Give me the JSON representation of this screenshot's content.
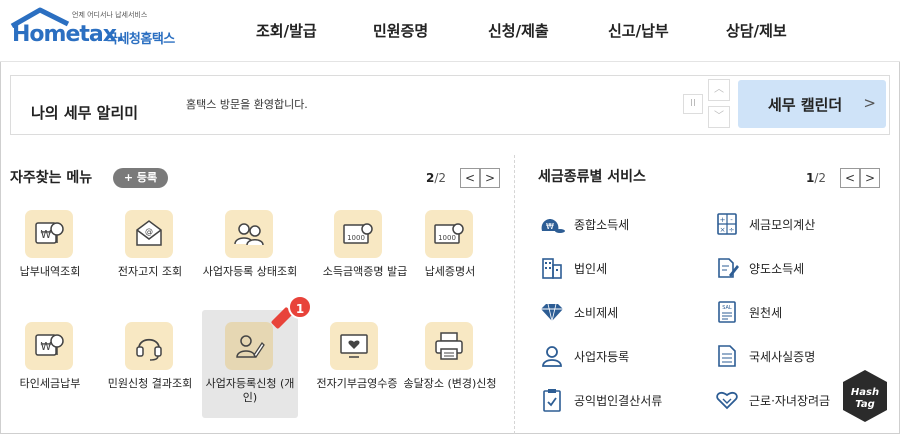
{
  "header": {
    "logo_tagline": "언제 어디서나 납세서비스",
    "logo_text": "Hometax.",
    "logo_kr": "국세청홈택스",
    "nav": [
      "조회/발급",
      "민원증명",
      "신청/제출",
      "신고/납부",
      "상담/제보"
    ]
  },
  "notice": {
    "title": "나의 세무 알리미",
    "message": "홈택스 방문을 환영합니다.",
    "pause_symbol": "II",
    "up_symbol": "︿",
    "down_symbol": "﹀",
    "calendar_button": "세무 캘린더",
    "calendar_chevron": ">"
  },
  "frequent": {
    "title": "자주찾는 메뉴",
    "register_button": "+ 등록",
    "page_current": "2",
    "page_total": "/2",
    "prev": "<",
    "next": ">",
    "items": [
      {
        "label": "납부내역조회",
        "icon": "won-search-icon"
      },
      {
        "label": "전자고지 조회",
        "icon": "envelope-at-icon"
      },
      {
        "label": "사업자등록 상태조회",
        "icon": "people-search-icon"
      },
      {
        "label": "소득금액증명 발급",
        "icon": "certificate-1000-icon"
      },
      {
        "label": "납세증명서",
        "icon": "certificate-1000-icon"
      },
      {
        "label": "타인세금납부",
        "icon": "won-search-icon"
      },
      {
        "label": "민원신청 결과조회",
        "icon": "headset-icon"
      },
      {
        "label": "사업자등록신청 (개인)",
        "icon": "person-pen-icon"
      },
      {
        "label": "전자기부금영수증",
        "icon": "monitor-heart-icon"
      },
      {
        "label": "송달장소 (변경)신청",
        "icon": "printer-icon"
      }
    ],
    "badge_number": "1"
  },
  "services": {
    "title": "세금종류별 서비스",
    "page_current": "1",
    "page_total": "/2",
    "prev": "<",
    "next": ">",
    "items": [
      {
        "label": "종합소득세",
        "icon": "money-bag-icon"
      },
      {
        "label": "세금모의계산",
        "icon": "calculator-icon"
      },
      {
        "label": "법인세",
        "icon": "building-icon"
      },
      {
        "label": "양도소득세",
        "icon": "document-pen-icon"
      },
      {
        "label": "소비제세",
        "icon": "diamond-icon"
      },
      {
        "label": "원천세",
        "icon": "receipt-icon"
      },
      {
        "label": "사업자등록",
        "icon": "person-icon"
      },
      {
        "label": "국세사실증명",
        "icon": "document-icon"
      },
      {
        "label": "공익법인결산서류",
        "icon": "clipboard-check-icon"
      },
      {
        "label": "근로·자녀장려금",
        "icon": "heart-hands-icon"
      }
    ]
  },
  "watermark": {
    "line1": "Hash",
    "line2": "Tag"
  },
  "colors": {
    "brand_blue": "#2b6fc1",
    "icon_bg": "#f8e8c3",
    "calendar_bg": "#cfe3f8",
    "badge_red": "#e8433a"
  }
}
